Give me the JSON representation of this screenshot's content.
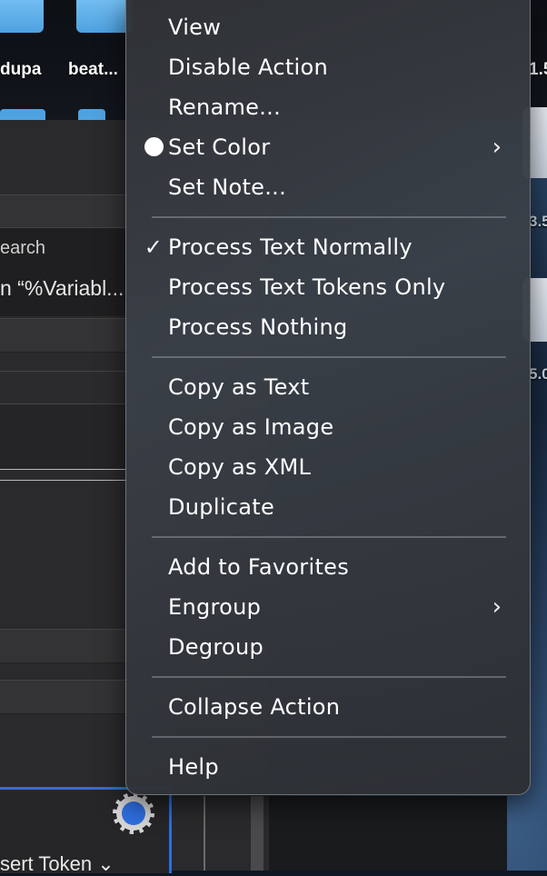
{
  "desktop": {
    "labels": [
      "dupa",
      "beat...",
      "1.5",
      "3.5",
      "5.0"
    ]
  },
  "app": {
    "search_label": "earch",
    "variable_text": "n “%Variabl...",
    "insert_token_label": "sert Token ⌄"
  },
  "menu": {
    "items": [
      {
        "label": "View"
      },
      {
        "label": "Disable Action"
      },
      {
        "label": "Rename..."
      },
      {
        "label": "Set Color",
        "submenu": true,
        "lead": "circle"
      },
      {
        "label": "Set Note..."
      },
      {
        "label": "Process Text Normally",
        "checked": true
      },
      {
        "label": "Process Text Tokens Only"
      },
      {
        "label": "Process Nothing"
      },
      {
        "label": "Copy as Text"
      },
      {
        "label": "Copy as Image"
      },
      {
        "label": "Copy as XML"
      },
      {
        "label": "Duplicate"
      },
      {
        "label": "Add to Favorites"
      },
      {
        "label": "Engroup",
        "submenu": true
      },
      {
        "label": "Degroup"
      },
      {
        "label": "Collapse Action"
      },
      {
        "label": "Help"
      }
    ],
    "check_mark": "✓",
    "chevron": "›"
  },
  "colors": {
    "accent": "#2f6fdd",
    "menu_text": "#ffffff"
  }
}
